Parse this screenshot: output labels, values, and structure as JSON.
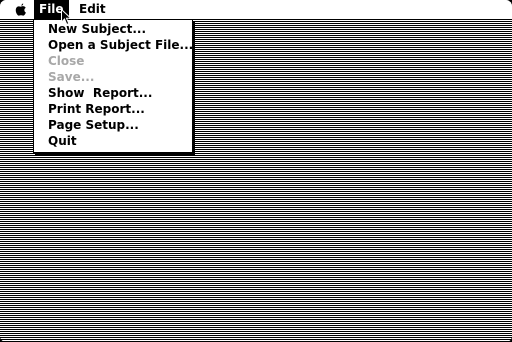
{
  "menubar": {
    "apple_icon": "apple-icon",
    "file_label": "File",
    "edit_label": "Edit"
  },
  "file_menu": {
    "items": [
      {
        "label": "New Subject...",
        "enabled": true
      },
      {
        "label": "Open a Subject File...",
        "enabled": true
      },
      {
        "label": "Close",
        "enabled": false
      },
      {
        "label": "Save...",
        "enabled": false
      },
      {
        "label": "Show  Report...",
        "enabled": true
      },
      {
        "label": "Print Report...",
        "enabled": true
      },
      {
        "label": "Page Setup...",
        "enabled": true
      },
      {
        "label": "Quit",
        "enabled": true
      }
    ]
  },
  "colors": {
    "foreground": "#000000",
    "background": "#ffffff",
    "disabled_text": "#a8a8a8"
  }
}
